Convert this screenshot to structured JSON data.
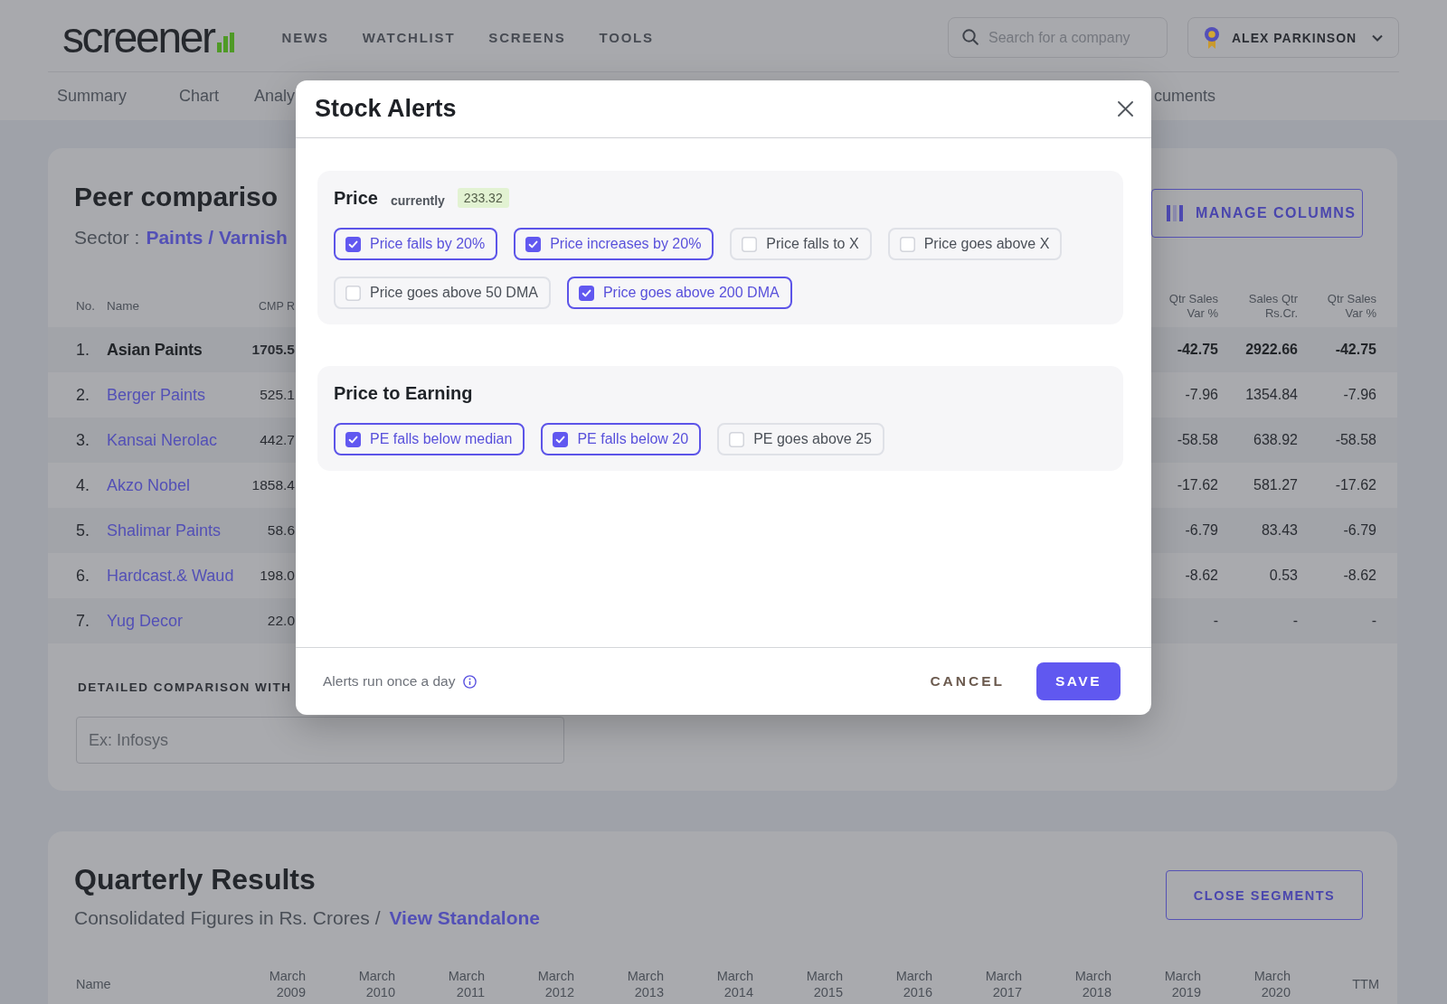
{
  "header": {
    "logo": "screener",
    "nav": [
      {
        "label": "NEWS"
      },
      {
        "label": "WATCHLIST"
      },
      {
        "label": "SCREENS"
      },
      {
        "label": "TOOLS"
      }
    ],
    "search": {
      "placeholder": "Search for a company"
    },
    "user": {
      "name": "ALEX PARKINSON"
    }
  },
  "section_tabs_left": [
    {
      "label": "Summary"
    },
    {
      "label": "Chart"
    },
    {
      "label": "Analy"
    }
  ],
  "section_tabs_right": [
    {
      "label": "cuments"
    }
  ],
  "peer_comparison": {
    "title": "Peer compariso",
    "sector_label": "Sector :",
    "sector_link": "Paints / Varnish",
    "manage_columns": "MANAGE COLUMNS",
    "columns_left": [
      "No.",
      "Name",
      "CMP R"
    ],
    "columns_right": [
      "Qtr Sales Var %",
      "Sales Qtr Rs.Cr.",
      "Qtr Sales Var %"
    ],
    "rows": [
      {
        "kind": "current",
        "no": "1.",
        "name": "Asian Paints",
        "cmp": "1705.5",
        "values": [
          "-42.75",
          "2922.66",
          "-42.75"
        ]
      },
      {
        "kind": "peer",
        "no": "2.",
        "name": "Berger Paints",
        "cmp": "525.1",
        "values": [
          "-7.96",
          "1354.84",
          "-7.96"
        ]
      },
      {
        "kind": "peer",
        "no": "3.",
        "name": "Kansai Nerolac",
        "cmp": "442.7",
        "values": [
          "-58.58",
          "638.92",
          "-58.58"
        ]
      },
      {
        "kind": "peer",
        "no": "4.",
        "name": "Akzo Nobel",
        "cmp": "1858.4",
        "values": [
          "-17.62",
          "581.27",
          "-17.62"
        ]
      },
      {
        "kind": "peer",
        "no": "5.",
        "name": "Shalimar Paints",
        "cmp": "58.6",
        "values": [
          "-6.79",
          "83.43",
          "-6.79"
        ]
      },
      {
        "kind": "peer",
        "no": "6.",
        "name": "Hardcast.& Waud",
        "cmp": "198.0",
        "values": [
          "-8.62",
          "0.53",
          "-8.62"
        ]
      },
      {
        "kind": "peer",
        "no": "7.",
        "name": "Yug Decor",
        "cmp": "22.0",
        "values": [
          "-",
          "-",
          "-"
        ]
      }
    ],
    "comparison_label": "DETAILED COMPARISON WITH",
    "comparison_input": {
      "placeholder": "Ex: Infosys"
    }
  },
  "quarterly_results": {
    "title": "Quarterly Results",
    "subtitle": "Consolidated Figures in Rs. Crores /",
    "link": "View Standalone",
    "button": "CLOSE SEGMENTS",
    "columns": [
      "Name",
      "March 2009",
      "March 2010",
      "March 2011",
      "March 2012",
      "March 2013",
      "March 2014",
      "March 2015",
      "March 2016",
      "March 2017",
      "March 2018",
      "March 2019",
      "March 2020",
      "TTM"
    ]
  },
  "modal": {
    "title": "Stock Alerts",
    "sections": [
      {
        "title": "Price",
        "note": "currently",
        "badge": "233.32",
        "options": [
          {
            "label": "Price falls by 20%",
            "checked": true
          },
          {
            "label": "Price increases by 20%",
            "checked": true
          },
          {
            "label": "Price falls to X",
            "checked": false
          },
          {
            "label": "Price goes above X",
            "checked": false
          },
          {
            "label": "Price goes above 50 DMA",
            "checked": false
          },
          {
            "label": "Price goes above 200 DMA",
            "checked": true
          }
        ]
      },
      {
        "title": "Price to Earning",
        "options": [
          {
            "label": "PE falls below median",
            "checked": true
          },
          {
            "label": "PE falls below 20",
            "checked": true
          },
          {
            "label": "PE goes above 25",
            "checked": false
          }
        ]
      }
    ],
    "footer_note": "Alerts run once a day",
    "buttons": [
      {
        "kind": "cancel",
        "label": "CANCEL"
      },
      {
        "kind": "save",
        "label": "SAVE"
      }
    ]
  }
}
